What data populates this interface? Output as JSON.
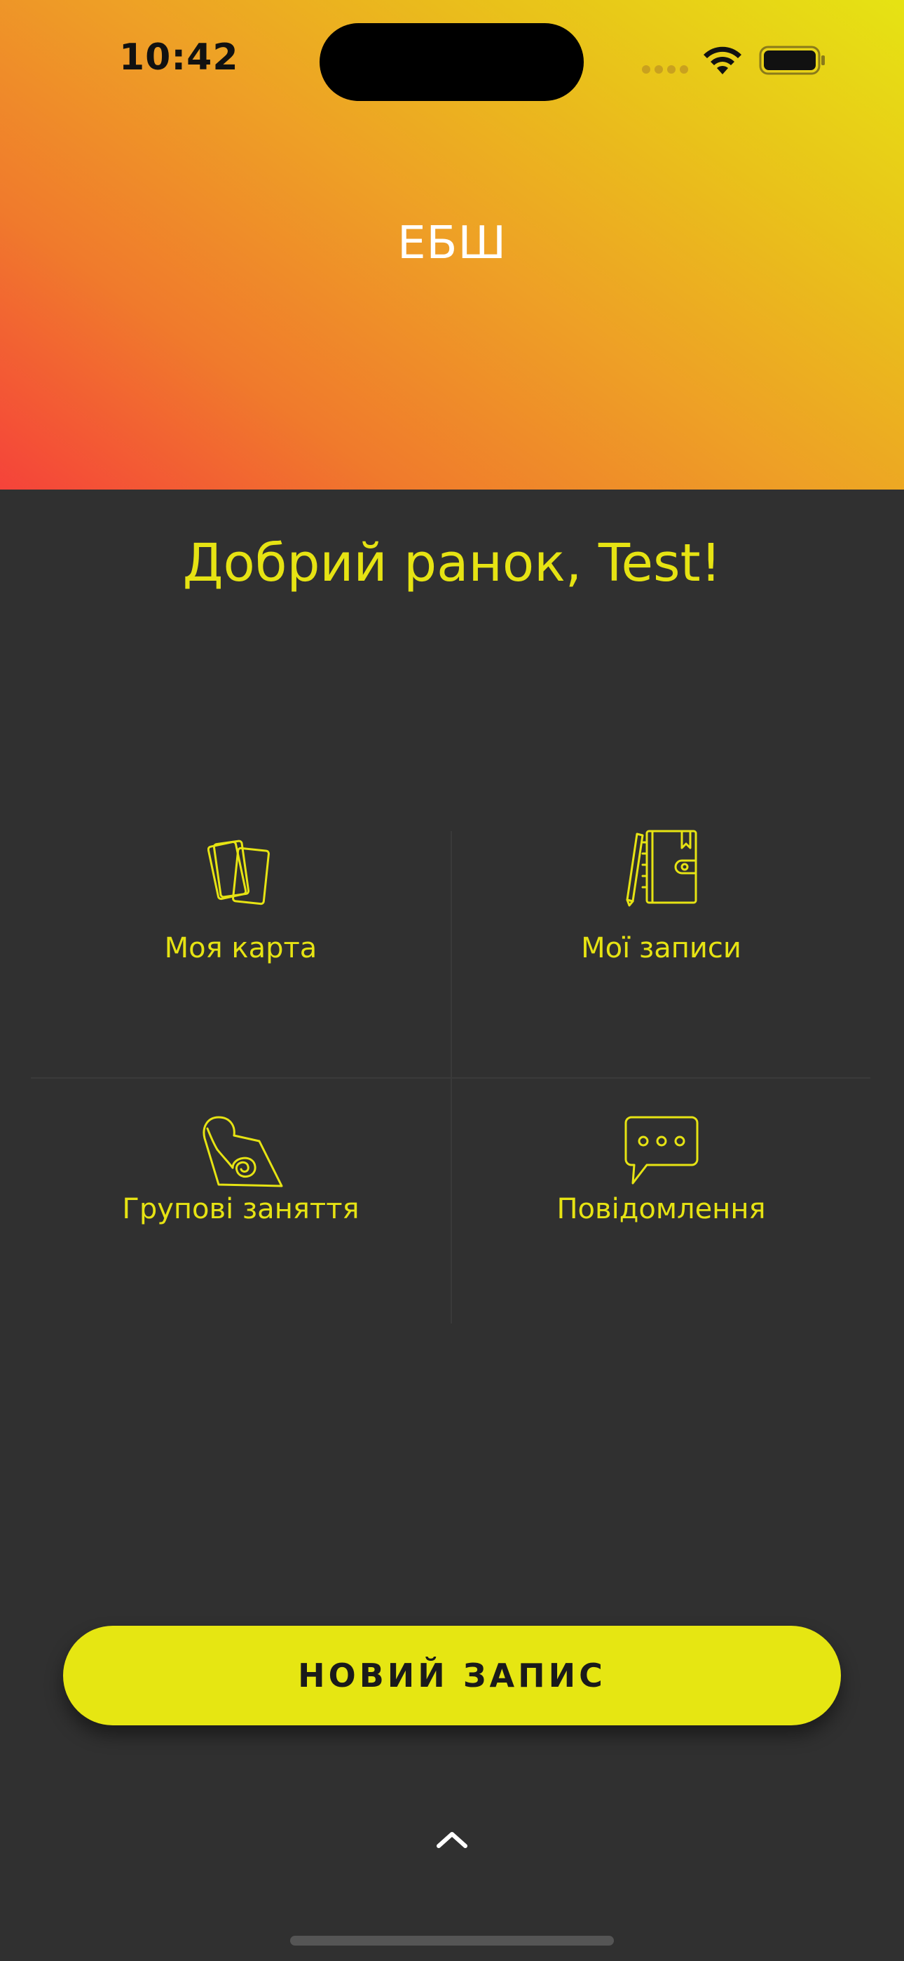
{
  "status_bar": {
    "time": "10:42"
  },
  "header": {
    "title": "ЕБШ"
  },
  "greeting": "Добрий ранок, Test!",
  "tiles": [
    {
      "label": "Моя карта",
      "icon": "cards-icon"
    },
    {
      "label": "Мої записи",
      "icon": "notebook-pencil-icon"
    },
    {
      "label": "Групові заняття",
      "icon": "yoga-mat-icon"
    },
    {
      "label": "Повідомлення",
      "icon": "chat-bubble-icon"
    }
  ],
  "cta": {
    "label": "НОВИЙ ЗАПИС"
  },
  "colors": {
    "accent": "#e6e313",
    "background": "#303030",
    "gradient_start": "#f5433a",
    "gradient_end": "#e6e313"
  }
}
